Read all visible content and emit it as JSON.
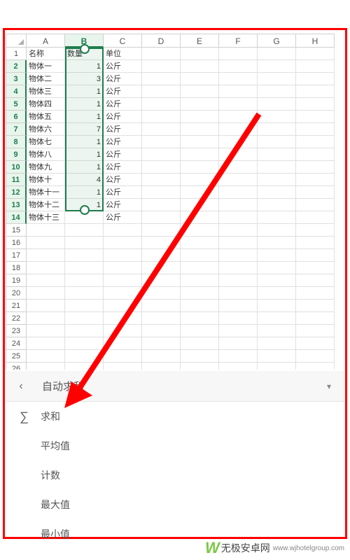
{
  "columns": [
    "A",
    "B",
    "C",
    "D",
    "E",
    "F",
    "G",
    "H"
  ],
  "selected_column_index": 1,
  "selected_row_start": 2,
  "selected_row_end": 14,
  "total_rows": 26,
  "table": {
    "headers": {
      "name": "名称",
      "qty": "数量",
      "unit": "单位"
    },
    "unit_label": "公斤",
    "rows": [
      {
        "name": "物体一",
        "qty": 1
      },
      {
        "name": "物体二",
        "qty": 3
      },
      {
        "name": "物体三",
        "qty": 1
      },
      {
        "name": "物体四",
        "qty": 1
      },
      {
        "name": "物体五",
        "qty": 1
      },
      {
        "name": "物体六",
        "qty": 7
      },
      {
        "name": "物体七",
        "qty": 1
      },
      {
        "name": "物体八",
        "qty": 1
      },
      {
        "name": "物体九",
        "qty": 1
      },
      {
        "name": "物体十",
        "qty": 4
      },
      {
        "name": "物体十一",
        "qty": 1
      },
      {
        "name": "物体十二",
        "qty": 1
      },
      {
        "name": "物体十三",
        "qty": ""
      }
    ]
  },
  "panel": {
    "title": "自动求和",
    "items": [
      {
        "icon": "∑",
        "label": "求和"
      },
      {
        "icon": "",
        "label": "平均值"
      },
      {
        "icon": "",
        "label": "计数"
      },
      {
        "icon": "",
        "label": "最大值"
      },
      {
        "icon": "",
        "label": "最小值"
      }
    ]
  },
  "watermark": {
    "brand": "无极安卓网",
    "url": "www.wjhotelgroup.com"
  }
}
